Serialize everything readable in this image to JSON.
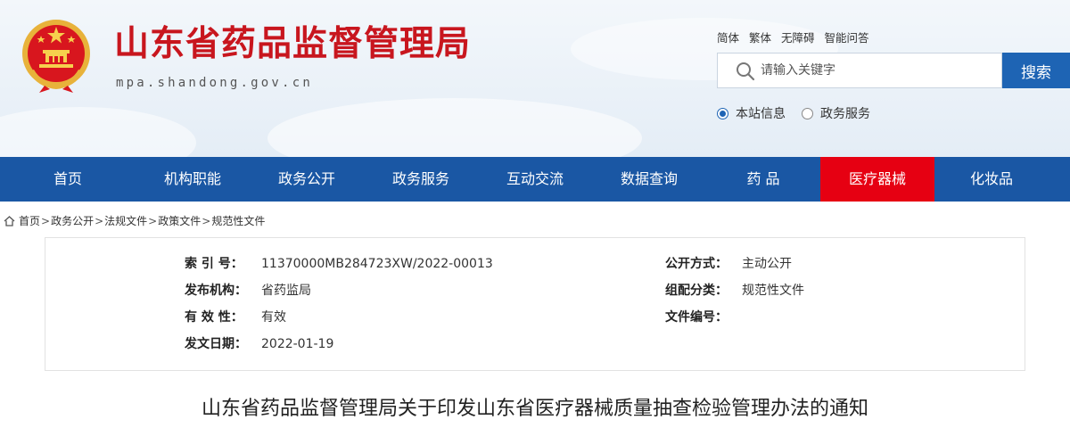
{
  "header": {
    "site_name": "山东省药品监督管理局",
    "site_domain": "mpa.shandong.gov.cn",
    "top_links": [
      "简体",
      "繁体",
      "无障碍",
      "智能问答"
    ],
    "search": {
      "placeholder": "请输入关键字",
      "button_label": "搜索"
    },
    "scope_options": [
      {
        "label": "本站信息",
        "selected": true
      },
      {
        "label": "政务服务",
        "selected": false
      }
    ]
  },
  "nav": {
    "items": [
      "首页",
      "机构职能",
      "政务公开",
      "政务服务",
      "互动交流",
      "数据查询",
      "药 品",
      "医疗器械",
      "化妆品"
    ],
    "active_index": 7,
    "active_color": "#e60012",
    "bar_color": "#1a57a4"
  },
  "breadcrumb": [
    "首页",
    "政务公开",
    "法规文件",
    "政策文件",
    "规范性文件"
  ],
  "info": {
    "index_label": "索 引 号：",
    "index_value": "11370000MB284723XW/2022-00013",
    "publisher_label": "发布机构：",
    "publisher_value": "省药监局",
    "validity_label": "有 效 性：",
    "validity_value": "有效",
    "date_label": "发文日期：",
    "date_value": "2022-01-19",
    "open_label": "公开方式：",
    "open_value": "主动公开",
    "category_label": "组配分类：",
    "category_value": "规范性文件",
    "docno_label": "文件编号：",
    "docno_value": ""
  },
  "document": {
    "title": "山东省药品监督管理局关于印发山东省医疗器械质量抽查检验管理办法的通知"
  }
}
